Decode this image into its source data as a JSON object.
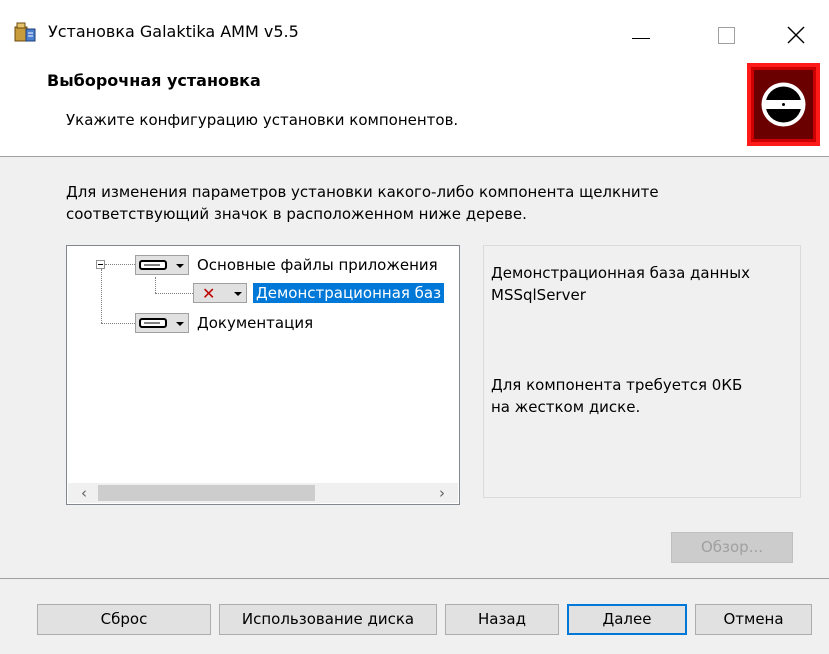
{
  "window": {
    "title": "Установка Galaktika AMM v5.5"
  },
  "icons": {
    "app": "installer-package-icon",
    "logo": "disc-install-icon"
  },
  "banner": {
    "title": "Выборочная установка",
    "subtitle": "Укажите конфигурацию установки компонентов.",
    "logo_color": "#cc0000"
  },
  "instructions": {
    "line1": "Для изменения параметров установки какого-либо компонента щелкните",
    "line2": "соответствующий значок в расположенном ниже дереве."
  },
  "tree": {
    "items": [
      {
        "label": "Основные файлы приложения",
        "icon": "drive-icon",
        "state": "installed"
      },
      {
        "label": "Демонстрационная баз",
        "icon": "x-icon",
        "state": "not-installed",
        "selected": true
      },
      {
        "label": "Документация",
        "icon": "drive-icon",
        "state": "installed"
      }
    ],
    "scroll_left": "‹",
    "scroll_right": "›"
  },
  "description": {
    "name_line1": "Демонстрационная база данных",
    "name_line2": "MSSqlServer",
    "req_line1": "Для компонента требуется 0КБ",
    "req_line2": "на жестком диске."
  },
  "buttons": {
    "browse": "Обзор...",
    "reset": "Сброс",
    "disk_usage": "Использование диска",
    "back": "Назад",
    "next": "Далее",
    "cancel": "Отмена"
  },
  "colors": {
    "selection": "#0078d7",
    "x_mark": "#c00000"
  }
}
